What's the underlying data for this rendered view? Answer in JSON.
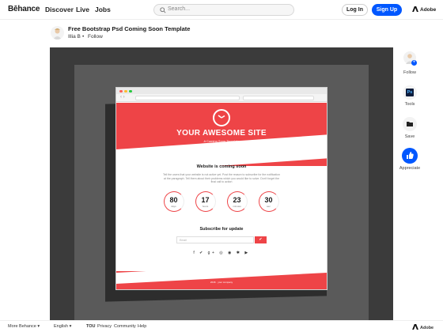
{
  "header": {
    "logo": "Bēhance",
    "nav": [
      "Discover",
      "Live",
      "Jobs"
    ],
    "search_placeholder": "Search...",
    "login": "Log In",
    "signup": "Sign Up",
    "adobe": "Adobe"
  },
  "project": {
    "title": "Free Bootstrap Psd Coming Soon Template",
    "author": "Illia B",
    "separator": "•",
    "follow": "Follow"
  },
  "mockup": {
    "site_title": "YOUR AWESOME SITE",
    "site_subtitle": "A Coming Soon Template",
    "coming_title": "Website is coming soon",
    "coming_text": "Tell the users that your website is not active yet. Post the reason to subscribe for the notification at the paragraph. Tell them about their problems which you would like to solve. Don't forget the final call to action",
    "counters": [
      {
        "value": "80",
        "label": "days"
      },
      {
        "value": "17",
        "label": "hours"
      },
      {
        "value": "23",
        "label": "minutes"
      },
      {
        "value": "30",
        "label": "sec"
      }
    ],
    "subscribe_title": "Subscribe for update",
    "email_placeholder": "Email",
    "send_icon": "✔",
    "socials": "f ✔ g+ ◎ ◉ ✱ ▶",
    "footer": "2016 · your company"
  },
  "sidebar": {
    "follow": "Follow",
    "tools": "Tools",
    "tools_icon_text": "Ps",
    "save": "Save",
    "appreciate": "Appreciate",
    "plus": "+"
  },
  "footer": {
    "more": "More Behance",
    "language": "English",
    "links": [
      "TOU",
      "Privacy",
      "Community",
      "Help"
    ],
    "adobe": "Adobe"
  },
  "colors": {
    "accent": "#0057ff",
    "mockup_red": "#ee4447"
  }
}
